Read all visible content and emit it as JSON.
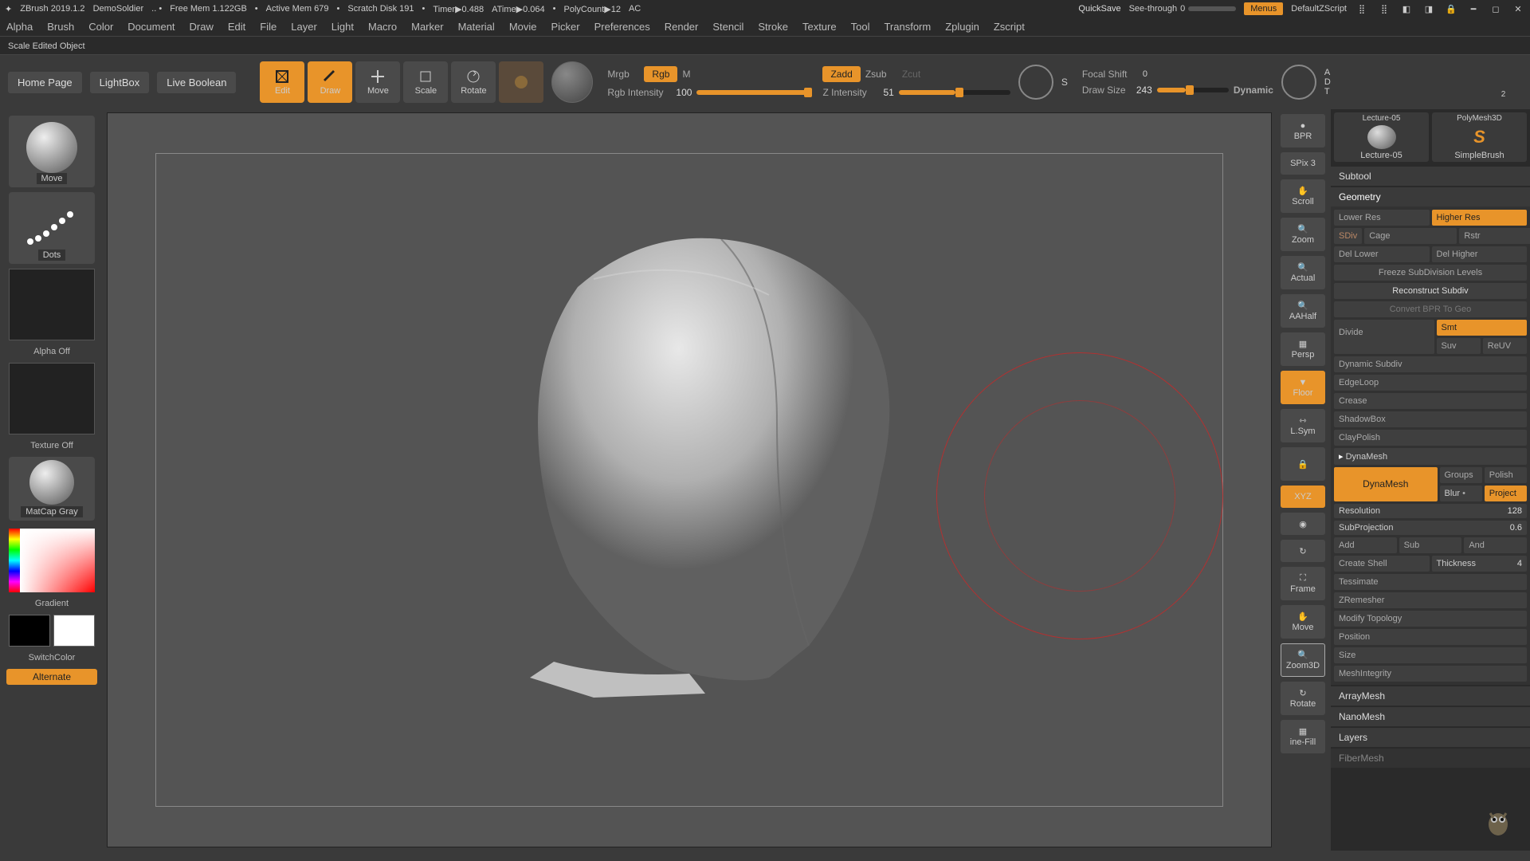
{
  "title": {
    "app": "ZBrush 2019.1.2",
    "proj": "DemoSoldier",
    "mem": "Free Mem 1.122GB",
    "amem": "Active Mem 679",
    "scratch": "Scratch Disk 191",
    "timer": "Timer▶0.488",
    "atime": "ATime▶0.064",
    "poly": "PolyCount▶12",
    "ac": "AC",
    "quick": "QuickSave",
    "see": "See-through",
    "seeval": "0",
    "menus": "Menus",
    "script": "DefaultZScript"
  },
  "menu": [
    "Alpha",
    "Brush",
    "Color",
    "Document",
    "Draw",
    "Edit",
    "File",
    "Layer",
    "Light",
    "Macro",
    "Marker",
    "Material",
    "Movie",
    "Picker",
    "Preferences",
    "Render",
    "Stencil",
    "Stroke",
    "Texture",
    "Tool",
    "Transform",
    "Zplugin",
    "Zscript"
  ],
  "hint": "Scale Edited Object",
  "toolbar": {
    "home": "Home Page",
    "light": "LightBox",
    "live": "Live Boolean",
    "edit": "Edit",
    "draw": "Draw",
    "move": "Move",
    "scale": "Scale",
    "rotate": "Rotate",
    "mrgb": "Mrgb",
    "rgb": "Rgb",
    "m": "M",
    "rgbint": "Rgb Intensity",
    "rgbintval": "100",
    "zadd": "Zadd",
    "zsub": "Zsub",
    "zcut": "Zcut",
    "zint": "Z Intensity",
    "zintval": "51",
    "focal": "Focal Shift",
    "focalval": "0",
    "drawsize": "Draw Size",
    "drawsizeval": "243",
    "dynamic": "Dynamic",
    "a": "A",
    "d": "D",
    "t": "T",
    "s": "S"
  },
  "left": {
    "brush": "Move",
    "stroke": "Dots",
    "alpha": "Alpha Off",
    "tex": "Texture Off",
    "mat": "MatCap Gray",
    "grad": "Gradient",
    "switch": "SwitchColor",
    "alt": "Alternate"
  },
  "right": [
    "BPR",
    "SPix 3",
    "Scroll",
    "Zoom",
    "Actual",
    "AAHalf",
    "Persp",
    "Floor",
    "L.Sym",
    "",
    "XYZ",
    "",
    "",
    "Frame",
    "Move",
    "Zoom3D",
    "Rotate",
    "ine-Fill"
  ],
  "side": {
    "top": [
      {
        "t": "Lecture-05",
        "b": "Lecture-05"
      },
      {
        "t": "PolyMesh3D",
        "b": "SimpleBrush",
        "num": "2"
      }
    ],
    "subtool": "Subtool",
    "geometry": "Geometry",
    "geo": {
      "lower": "Lower Res",
      "higher": "Higher Res",
      "sdiv": "SDiv",
      "cage": "Cage",
      "rstr": "Rstr",
      "dellow": "Del Lower",
      "delhigh": "Del Higher",
      "freeze": "Freeze SubDivision Levels",
      "recon": "Reconstruct Subdiv",
      "convert": "Convert BPR To Geo",
      "divide": "Divide",
      "smt": "Smt",
      "suv": "Suv",
      "reuv": "ReUV"
    },
    "sections": [
      "Dynamic Subdiv",
      "EdgeLoop",
      "Crease",
      "ShadowBox",
      "ClayPolish"
    ],
    "dyna_h": "DynaMesh",
    "dyna": {
      "btn": "DynaMesh",
      "groups": "Groups",
      "polish": "Polish",
      "blur": "Blur",
      "project": "Project",
      "res": "Resolution",
      "resval": "128",
      "subp": "SubProjection",
      "subpval": "0.6",
      "add": "Add",
      "sub": "Sub",
      "and": "And",
      "shell": "Create Shell",
      "thick": "Thickness",
      "thickval": "4"
    },
    "sections2": [
      "Tessimate",
      "ZRemesher",
      "Modify Topology",
      "Position",
      "Size",
      "MeshIntegrity"
    ],
    "bottom": [
      "ArrayMesh",
      "NanoMesh",
      "Layers",
      "FiberMesh"
    ]
  }
}
